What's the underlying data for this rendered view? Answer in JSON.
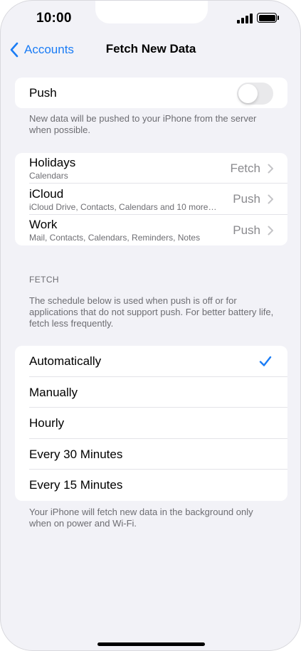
{
  "status_bar": {
    "time": "10:00"
  },
  "nav": {
    "back_label": "Accounts",
    "title": "Fetch New Data"
  },
  "push": {
    "label": "Push",
    "enabled": false,
    "footer": "New data will be pushed to your iPhone from the server when possible."
  },
  "accounts": [
    {
      "name": "Holidays",
      "detail": "Calendars",
      "value": "Fetch"
    },
    {
      "name": "iCloud",
      "detail": "iCloud Drive, Contacts, Calendars and 10 more…",
      "value": "Push"
    },
    {
      "name": "Work",
      "detail": "Mail, Contacts, Calendars, Reminders, Notes",
      "value": "Push"
    }
  ],
  "fetch": {
    "header": "FETCH",
    "description": "The schedule below is used when push is off or for applications that do not support push. For better battery life, fetch less frequently.",
    "options": [
      "Automatically",
      "Manually",
      "Hourly",
      "Every 30 Minutes",
      "Every 15 Minutes"
    ],
    "selected": "Automatically",
    "footer": "Your iPhone will fetch new data in the background only when on power and Wi-Fi."
  },
  "colors": {
    "accent": "#1a7cf5",
    "background": "#f2f2f7",
    "secondary_text": "#6d6d72"
  },
  "icons": {
    "back": "chevron-left-icon",
    "disclosure": "chevron-right-icon",
    "selected": "checkmark-icon"
  }
}
